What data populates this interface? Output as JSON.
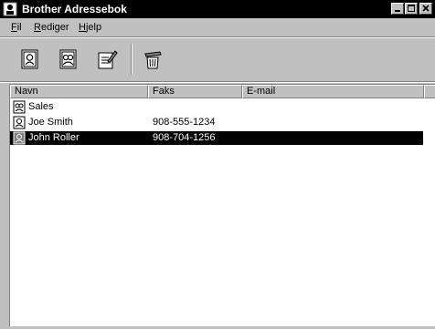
{
  "window": {
    "title": "Brother Adressebok"
  },
  "menu": {
    "items": [
      {
        "underline": "F",
        "rest": "il"
      },
      {
        "underline": "R",
        "rest": "ediger"
      },
      {
        "underline": "H",
        "rest": "jelp"
      }
    ]
  },
  "toolbar": {
    "buttons": [
      "new-member-icon",
      "new-group-icon",
      "edit-icon",
      "delete-icon"
    ]
  },
  "list": {
    "columns": [
      "Navn",
      "Faks",
      "E-mail"
    ],
    "rows": [
      {
        "type": "group",
        "name": "Sales",
        "fax": "",
        "email": "",
        "selected": false
      },
      {
        "type": "member",
        "name": "Joe Smith",
        "fax": "908-555-1234",
        "email": "",
        "selected": false
      },
      {
        "type": "member",
        "name": "John Roller",
        "fax": "908-704-1256",
        "email": "",
        "selected": true
      }
    ]
  }
}
